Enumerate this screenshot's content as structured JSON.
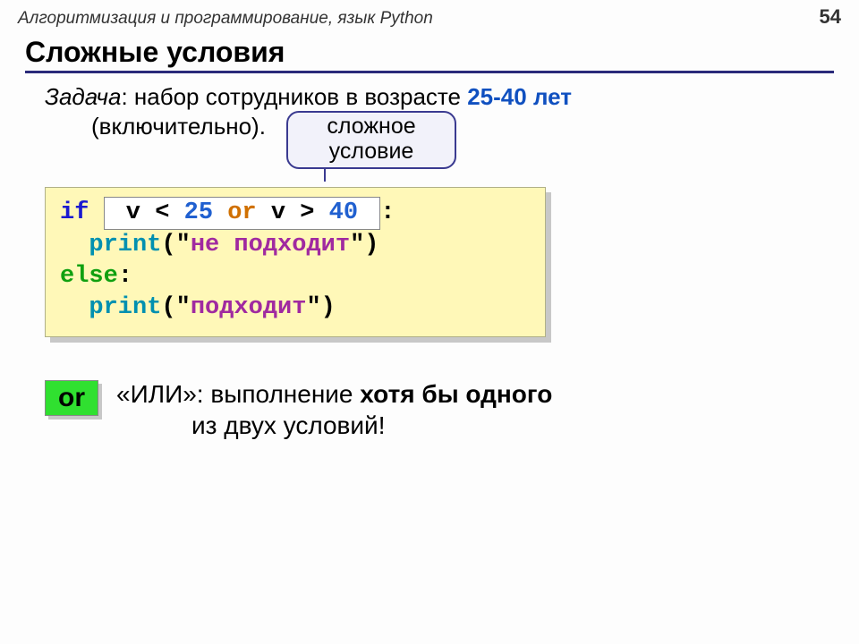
{
  "header": {
    "course": "Алгоритмизация и программирование, язык Python",
    "page": "54"
  },
  "title": "Сложные условия",
  "task": {
    "label": "Задача",
    "before": ": набор сотрудников в возрасте ",
    "range": "25-40 лет",
    "after": "(включительно).",
    "callout_l1": "сложное",
    "callout_l2": "условие"
  },
  "code": {
    "if": "if",
    "cond_pre": " v < ",
    "n25": "25",
    "or": " or ",
    "cond_mid": "v > ",
    "n40": "40",
    "cond_post": " ",
    "colon": ":",
    "indent": "  ",
    "print": "print",
    "s1_open": "(\"",
    "s1_text": "не подходит",
    "s1_close": "\")",
    "else": "else",
    "s2_text": "подходит"
  },
  "note": {
    "badge": "or",
    "line1_a": "«ИЛИ»: выполнение ",
    "line1_b": "хотя бы одного",
    "line2": "из двух условий!"
  }
}
